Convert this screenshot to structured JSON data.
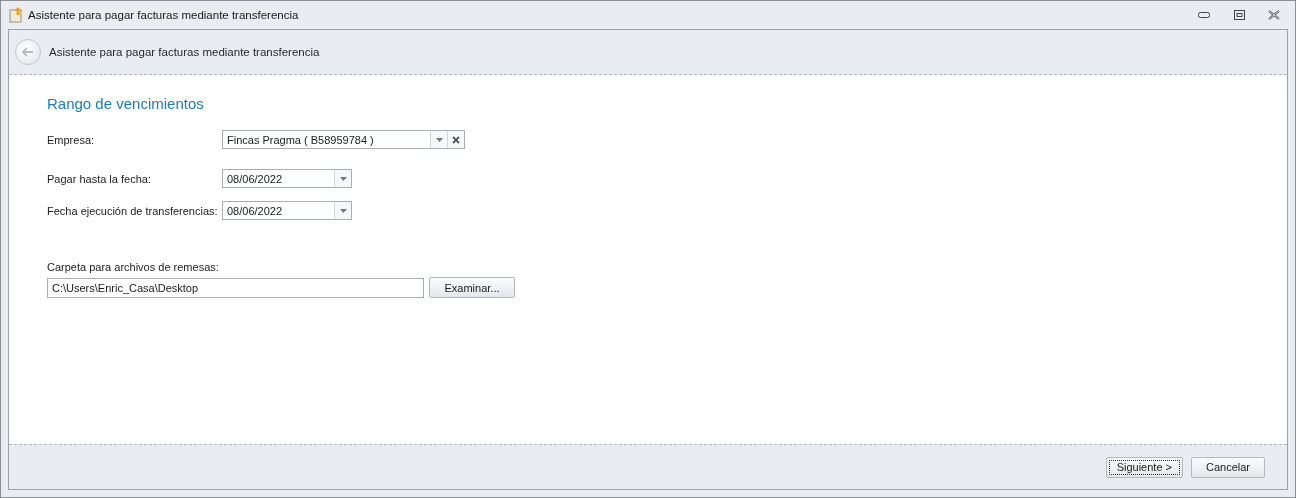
{
  "window": {
    "title": "Asistente para pagar facturas mediante transferencia"
  },
  "header": {
    "title": "Asistente para pagar facturas mediante transferencia"
  },
  "section": {
    "title": "Rango de vencimientos"
  },
  "fields": [
    {
      "kind": "combo",
      "label": "Empresa:",
      "value": "Fincas Pragma ( B58959784 )",
      "clearable": true
    },
    {
      "kind": "date",
      "label": "Pagar hasta la fecha:",
      "value": "08/06/2022"
    },
    {
      "kind": "date",
      "label": "Fecha ejecución de transferencias:",
      "value": "08/06/2022"
    }
  ],
  "folder": {
    "label": "Carpeta para archivos de remesas:",
    "value": "C:\\Users\\Enric_Casa\\Desktop",
    "button": "Examinar..."
  },
  "buttons": [
    {
      "label": "Siguiente >",
      "focused": true
    },
    {
      "label": "Cancelar",
      "focused": false
    }
  ]
}
